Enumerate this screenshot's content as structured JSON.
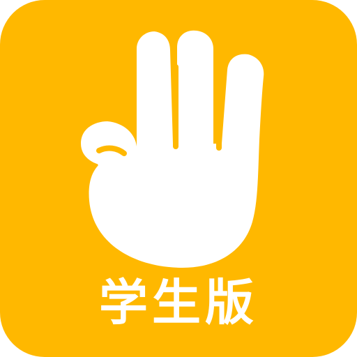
{
  "app_icon": {
    "background_color": "#FFB800",
    "hand_color": "#FFFFFF",
    "label": "学生版",
    "icon": "three-finger-hand-icon"
  }
}
